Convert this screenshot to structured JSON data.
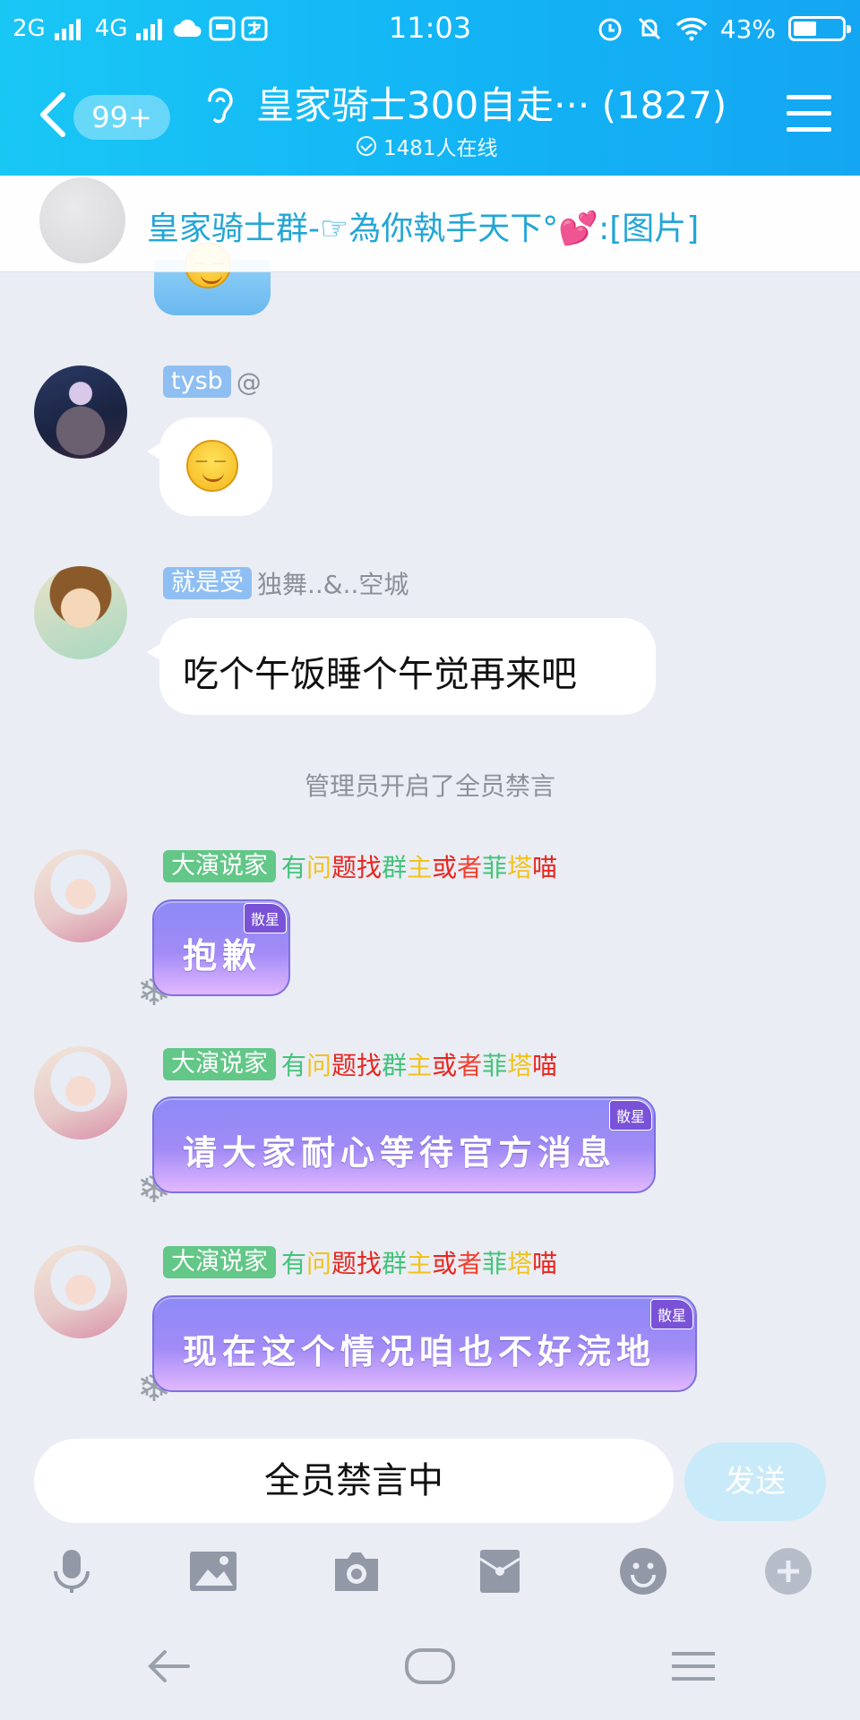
{
  "status_bar": {
    "net1": "2G",
    "net2": "4G",
    "time": "11:03",
    "battery": "43%"
  },
  "header": {
    "unread_badge": "99+",
    "title": "皇家骑士300自走··· (1827)",
    "online": "1481人在线"
  },
  "notice": {
    "text": "皇家骑士群-☞為你執手天下°💕:[图片]"
  },
  "messages": [
    {
      "tag": "tysb",
      "name": "@",
      "type": "emoji",
      "emoji": "smirk-face-emoji"
    },
    {
      "tag": "就是受",
      "name": "独舞..&..空城",
      "type": "text",
      "text": "吃个午饭睡个午觉再来吧"
    }
  ],
  "system_message": "管理员开启了全员禁言",
  "admin_messages": [
    {
      "tag": "大演说家",
      "text": "抱歉",
      "badge": "散星"
    },
    {
      "tag": "大演说家",
      "text": "请大家耐心等待官方消息",
      "badge": "散星"
    },
    {
      "tag": "大演说家",
      "text": "现在这个情况咱也不好浣地",
      "badge": "散星"
    }
  ],
  "colorful_name": [
    {
      "ch": "有",
      "color": "#43c37a"
    },
    {
      "ch": "问",
      "color": "#f2c21b"
    },
    {
      "ch": "题",
      "color": "#e8261e"
    },
    {
      "ch": "找",
      "color": "#e8261e"
    },
    {
      "ch": "群",
      "color": "#43c37a"
    },
    {
      "ch": "主",
      "color": "#f2c21b"
    },
    {
      "ch": "或",
      "color": "#e8261e"
    },
    {
      "ch": "者",
      "color": "#f2402f"
    },
    {
      "ch": "菲",
      "color": "#43c37a"
    },
    {
      "ch": "塔",
      "color": "#f2c21b"
    },
    {
      "ch": "喵",
      "color": "#e8261e"
    }
  ],
  "input": {
    "placeholder": "全员禁言中",
    "send_label": "发送"
  },
  "toolbar_icons": [
    "mic-icon",
    "image-icon",
    "camera-icon",
    "red-envelope-icon",
    "emoji-icon",
    "plus-icon"
  ],
  "nav_icons": [
    "back-icon",
    "home-icon",
    "menu-icon"
  ],
  "colors": {
    "header": "#14b4f4",
    "background": "#eaedf4",
    "bubble_purple": "#9a8af6",
    "send_disabled": "#c9eaf8"
  }
}
